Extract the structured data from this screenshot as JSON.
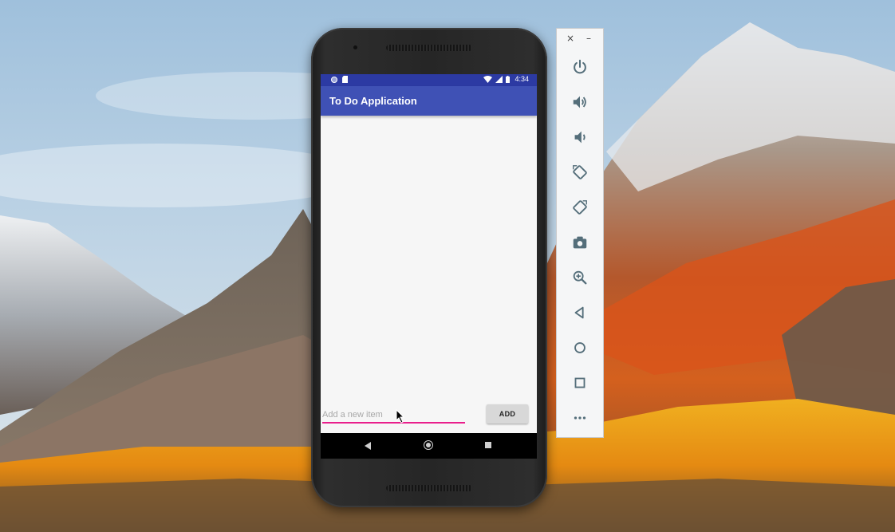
{
  "app": {
    "title": "To Do Application",
    "accent_color": "#3f51b5",
    "statusbar_color": "#2c3aa3"
  },
  "statusbar": {
    "time": "4:34",
    "left_icons": [
      "notification-dot-icon",
      "sd-card-icon"
    ],
    "right_icons": [
      "wifi-icon",
      "signal-icon",
      "battery-icon"
    ]
  },
  "input": {
    "placeholder": "Add a new item",
    "value": "",
    "underline_color": "#e91e8c"
  },
  "add_button": {
    "label": "ADD"
  },
  "navbar": {
    "icons": [
      "back-icon",
      "home-icon",
      "recents-icon"
    ]
  },
  "emulator_toolbar": {
    "window_controls": [
      "×",
      "–"
    ],
    "buttons": [
      "power-icon",
      "volume-up-icon",
      "volume-down-icon",
      "rotate-left-icon",
      "rotate-right-icon",
      "camera-icon",
      "zoom-icon",
      "back-icon",
      "home-icon",
      "overview-icon",
      "more-icon"
    ]
  }
}
